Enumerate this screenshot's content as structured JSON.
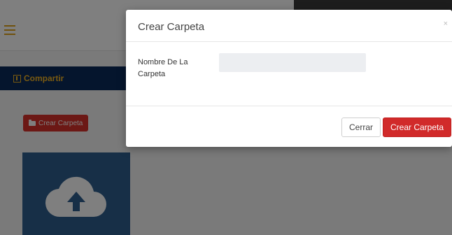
{
  "background": {
    "nav_item_label": "Compartir",
    "create_folder_button": "Crear Carpeta",
    "icons": [
      "hamburger-icon",
      "share-icon",
      "folder-icon",
      "cloud-upload-icon"
    ]
  },
  "modal": {
    "title": "Crear Carpeta",
    "close_symbol": "×",
    "field_label": "Nombre De La Carpeta",
    "field_value": "",
    "cancel_label": "Cerrar",
    "submit_label": "Crear Carpeta"
  },
  "colors": {
    "accent_red": "#d12a2a",
    "nav_blue": "#0b2a5a",
    "brand_gold": "#f0b323"
  }
}
